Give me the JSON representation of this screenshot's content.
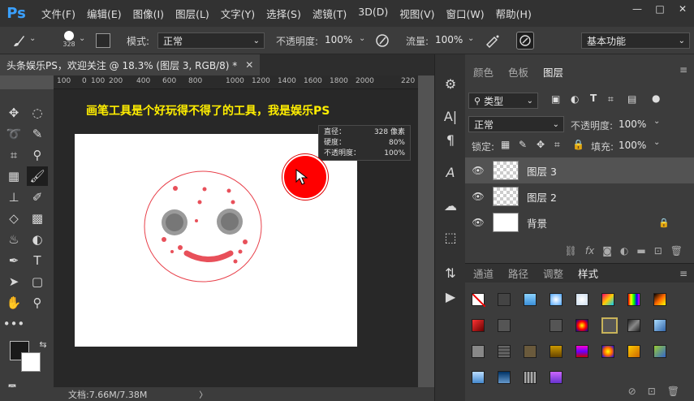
{
  "app": {
    "logo": "Ps"
  },
  "menu": [
    "文件(F)",
    "编辑(E)",
    "图像(I)",
    "图层(L)",
    "文字(Y)",
    "选择(S)",
    "滤镜(T)",
    "3D(D)",
    "视图(V)",
    "窗口(W)",
    "帮助(H)"
  ],
  "window_buttons": [
    "—",
    "□",
    "✕"
  ],
  "options": {
    "brush_size": "328",
    "mode_label": "模式:",
    "mode_value": "正常",
    "opacity_label": "不透明度:",
    "opacity_value": "100%",
    "flow_label": "流量:",
    "flow_value": "100%",
    "workspace": "基本功能"
  },
  "document": {
    "tab_title": "头条娱乐PS，欢迎关注 @ 18.3% (图层 3, RGB/8) *",
    "close": "✕",
    "caption": "画笔工具是个好玩得不得了的工具，我是娱乐PS",
    "status": "文档:7.66M/7.38M",
    "status_arrow": "〉"
  },
  "ruler": [
    "100",
    "0",
    "100",
    "200",
    "400",
    "600",
    "800",
    "1000",
    "1200",
    "1400",
    "1600",
    "1800",
    "2000",
    "220"
  ],
  "brush_info": {
    "diameter_label": "直径：",
    "diameter_value": "328 像素",
    "hardness_label": "硬度：",
    "hardness_value": "80%",
    "opacity_label": "不透明度：",
    "opacity_value": "100%"
  },
  "panels": {
    "top_tabs": [
      "颜色",
      "色板",
      "图层"
    ],
    "kind_filter": "类型",
    "blend_mode": "正常",
    "opacity_label": "不透明度:",
    "opacity_value": "100%",
    "lock_label": "锁定:",
    "fill_label": "填充:",
    "fill_value": "100%",
    "layers": [
      {
        "name": "图层 3",
        "selected": true
      },
      {
        "name": "图层 2",
        "selected": false
      },
      {
        "name": "背景",
        "selected": false,
        "locked": true
      }
    ],
    "bottom_tabs": [
      "通道",
      "路径",
      "调整",
      "样式"
    ]
  },
  "colors": {
    "brush": "#ff0000",
    "caption": "#ffee00",
    "face": "#e8404a",
    "eye": "#888888"
  }
}
